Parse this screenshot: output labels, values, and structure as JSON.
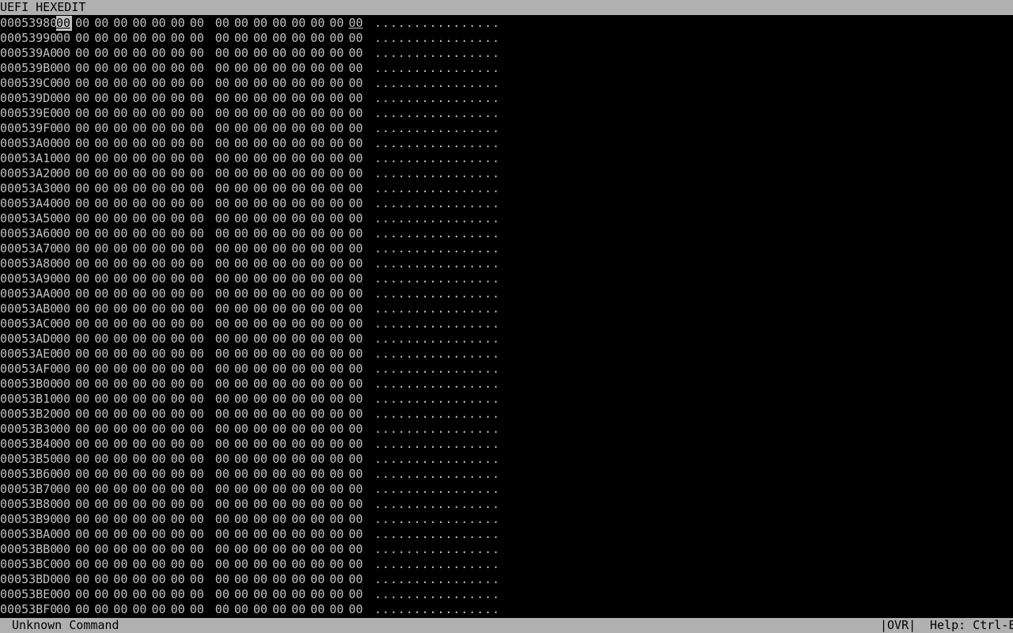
{
  "title": "UEFI HEXEDIT",
  "status": {
    "message": "Unknown Command",
    "mode": "|OVR|",
    "help": "Help: Ctrl-E"
  },
  "cursor": {
    "row": 0,
    "byte": 0
  },
  "rows": [
    {
      "address": "00053980",
      "bytes": [
        "00",
        "00",
        "00",
        "00",
        "00",
        "00",
        "00",
        "00",
        "00",
        "00",
        "00",
        "00",
        "00",
        "00",
        "00",
        "00"
      ],
      "ascii": "................"
    },
    {
      "address": "00053990",
      "bytes": [
        "00",
        "00",
        "00",
        "00",
        "00",
        "00",
        "00",
        "00",
        "00",
        "00",
        "00",
        "00",
        "00",
        "00",
        "00",
        "00"
      ],
      "ascii": "................"
    },
    {
      "address": "000539A0",
      "bytes": [
        "00",
        "00",
        "00",
        "00",
        "00",
        "00",
        "00",
        "00",
        "00",
        "00",
        "00",
        "00",
        "00",
        "00",
        "00",
        "00"
      ],
      "ascii": "................"
    },
    {
      "address": "000539B0",
      "bytes": [
        "00",
        "00",
        "00",
        "00",
        "00",
        "00",
        "00",
        "00",
        "00",
        "00",
        "00",
        "00",
        "00",
        "00",
        "00",
        "00"
      ],
      "ascii": "................"
    },
    {
      "address": "000539C0",
      "bytes": [
        "00",
        "00",
        "00",
        "00",
        "00",
        "00",
        "00",
        "00",
        "00",
        "00",
        "00",
        "00",
        "00",
        "00",
        "00",
        "00"
      ],
      "ascii": "................"
    },
    {
      "address": "000539D0",
      "bytes": [
        "00",
        "00",
        "00",
        "00",
        "00",
        "00",
        "00",
        "00",
        "00",
        "00",
        "00",
        "00",
        "00",
        "00",
        "00",
        "00"
      ],
      "ascii": "................"
    },
    {
      "address": "000539E0",
      "bytes": [
        "00",
        "00",
        "00",
        "00",
        "00",
        "00",
        "00",
        "00",
        "00",
        "00",
        "00",
        "00",
        "00",
        "00",
        "00",
        "00"
      ],
      "ascii": "................"
    },
    {
      "address": "000539F0",
      "bytes": [
        "00",
        "00",
        "00",
        "00",
        "00",
        "00",
        "00",
        "00",
        "00",
        "00",
        "00",
        "00",
        "00",
        "00",
        "00",
        "00"
      ],
      "ascii": "................"
    },
    {
      "address": "00053A00",
      "bytes": [
        "00",
        "00",
        "00",
        "00",
        "00",
        "00",
        "00",
        "00",
        "00",
        "00",
        "00",
        "00",
        "00",
        "00",
        "00",
        "00"
      ],
      "ascii": "................"
    },
    {
      "address": "00053A10",
      "bytes": [
        "00",
        "00",
        "00",
        "00",
        "00",
        "00",
        "00",
        "00",
        "00",
        "00",
        "00",
        "00",
        "00",
        "00",
        "00",
        "00"
      ],
      "ascii": "................"
    },
    {
      "address": "00053A20",
      "bytes": [
        "00",
        "00",
        "00",
        "00",
        "00",
        "00",
        "00",
        "00",
        "00",
        "00",
        "00",
        "00",
        "00",
        "00",
        "00",
        "00"
      ],
      "ascii": "................"
    },
    {
      "address": "00053A30",
      "bytes": [
        "00",
        "00",
        "00",
        "00",
        "00",
        "00",
        "00",
        "00",
        "00",
        "00",
        "00",
        "00",
        "00",
        "00",
        "00",
        "00"
      ],
      "ascii": "................"
    },
    {
      "address": "00053A40",
      "bytes": [
        "00",
        "00",
        "00",
        "00",
        "00",
        "00",
        "00",
        "00",
        "00",
        "00",
        "00",
        "00",
        "00",
        "00",
        "00",
        "00"
      ],
      "ascii": "................"
    },
    {
      "address": "00053A50",
      "bytes": [
        "00",
        "00",
        "00",
        "00",
        "00",
        "00",
        "00",
        "00",
        "00",
        "00",
        "00",
        "00",
        "00",
        "00",
        "00",
        "00"
      ],
      "ascii": "................"
    },
    {
      "address": "00053A60",
      "bytes": [
        "00",
        "00",
        "00",
        "00",
        "00",
        "00",
        "00",
        "00",
        "00",
        "00",
        "00",
        "00",
        "00",
        "00",
        "00",
        "00"
      ],
      "ascii": "................"
    },
    {
      "address": "00053A70",
      "bytes": [
        "00",
        "00",
        "00",
        "00",
        "00",
        "00",
        "00",
        "00",
        "00",
        "00",
        "00",
        "00",
        "00",
        "00",
        "00",
        "00"
      ],
      "ascii": "................"
    },
    {
      "address": "00053A80",
      "bytes": [
        "00",
        "00",
        "00",
        "00",
        "00",
        "00",
        "00",
        "00",
        "00",
        "00",
        "00",
        "00",
        "00",
        "00",
        "00",
        "00"
      ],
      "ascii": "................"
    },
    {
      "address": "00053A90",
      "bytes": [
        "00",
        "00",
        "00",
        "00",
        "00",
        "00",
        "00",
        "00",
        "00",
        "00",
        "00",
        "00",
        "00",
        "00",
        "00",
        "00"
      ],
      "ascii": "................"
    },
    {
      "address": "00053AA0",
      "bytes": [
        "00",
        "00",
        "00",
        "00",
        "00",
        "00",
        "00",
        "00",
        "00",
        "00",
        "00",
        "00",
        "00",
        "00",
        "00",
        "00"
      ],
      "ascii": "................"
    },
    {
      "address": "00053AB0",
      "bytes": [
        "00",
        "00",
        "00",
        "00",
        "00",
        "00",
        "00",
        "00",
        "00",
        "00",
        "00",
        "00",
        "00",
        "00",
        "00",
        "00"
      ],
      "ascii": "................"
    },
    {
      "address": "00053AC0",
      "bytes": [
        "00",
        "00",
        "00",
        "00",
        "00",
        "00",
        "00",
        "00",
        "00",
        "00",
        "00",
        "00",
        "00",
        "00",
        "00",
        "00"
      ],
      "ascii": "................"
    },
    {
      "address": "00053AD0",
      "bytes": [
        "00",
        "00",
        "00",
        "00",
        "00",
        "00",
        "00",
        "00",
        "00",
        "00",
        "00",
        "00",
        "00",
        "00",
        "00",
        "00"
      ],
      "ascii": "................"
    },
    {
      "address": "00053AE0",
      "bytes": [
        "00",
        "00",
        "00",
        "00",
        "00",
        "00",
        "00",
        "00",
        "00",
        "00",
        "00",
        "00",
        "00",
        "00",
        "00",
        "00"
      ],
      "ascii": "................"
    },
    {
      "address": "00053AF0",
      "bytes": [
        "00",
        "00",
        "00",
        "00",
        "00",
        "00",
        "00",
        "00",
        "00",
        "00",
        "00",
        "00",
        "00",
        "00",
        "00",
        "00"
      ],
      "ascii": "................"
    },
    {
      "address": "00053B00",
      "bytes": [
        "00",
        "00",
        "00",
        "00",
        "00",
        "00",
        "00",
        "00",
        "00",
        "00",
        "00",
        "00",
        "00",
        "00",
        "00",
        "00"
      ],
      "ascii": "................"
    },
    {
      "address": "00053B10",
      "bytes": [
        "00",
        "00",
        "00",
        "00",
        "00",
        "00",
        "00",
        "00",
        "00",
        "00",
        "00",
        "00",
        "00",
        "00",
        "00",
        "00"
      ],
      "ascii": "................"
    },
    {
      "address": "00053B20",
      "bytes": [
        "00",
        "00",
        "00",
        "00",
        "00",
        "00",
        "00",
        "00",
        "00",
        "00",
        "00",
        "00",
        "00",
        "00",
        "00",
        "00"
      ],
      "ascii": "................"
    },
    {
      "address": "00053B30",
      "bytes": [
        "00",
        "00",
        "00",
        "00",
        "00",
        "00",
        "00",
        "00",
        "00",
        "00",
        "00",
        "00",
        "00",
        "00",
        "00",
        "00"
      ],
      "ascii": "................"
    },
    {
      "address": "00053B40",
      "bytes": [
        "00",
        "00",
        "00",
        "00",
        "00",
        "00",
        "00",
        "00",
        "00",
        "00",
        "00",
        "00",
        "00",
        "00",
        "00",
        "00"
      ],
      "ascii": "................"
    },
    {
      "address": "00053B50",
      "bytes": [
        "00",
        "00",
        "00",
        "00",
        "00",
        "00",
        "00",
        "00",
        "00",
        "00",
        "00",
        "00",
        "00",
        "00",
        "00",
        "00"
      ],
      "ascii": "................"
    },
    {
      "address": "00053B60",
      "bytes": [
        "00",
        "00",
        "00",
        "00",
        "00",
        "00",
        "00",
        "00",
        "00",
        "00",
        "00",
        "00",
        "00",
        "00",
        "00",
        "00"
      ],
      "ascii": "................"
    },
    {
      "address": "00053B70",
      "bytes": [
        "00",
        "00",
        "00",
        "00",
        "00",
        "00",
        "00",
        "00",
        "00",
        "00",
        "00",
        "00",
        "00",
        "00",
        "00",
        "00"
      ],
      "ascii": "................"
    },
    {
      "address": "00053B80",
      "bytes": [
        "00",
        "00",
        "00",
        "00",
        "00",
        "00",
        "00",
        "00",
        "00",
        "00",
        "00",
        "00",
        "00",
        "00",
        "00",
        "00"
      ],
      "ascii": "................"
    },
    {
      "address": "00053B90",
      "bytes": [
        "00",
        "00",
        "00",
        "00",
        "00",
        "00",
        "00",
        "00",
        "00",
        "00",
        "00",
        "00",
        "00",
        "00",
        "00",
        "00"
      ],
      "ascii": "................"
    },
    {
      "address": "00053BA0",
      "bytes": [
        "00",
        "00",
        "00",
        "00",
        "00",
        "00",
        "00",
        "00",
        "00",
        "00",
        "00",
        "00",
        "00",
        "00",
        "00",
        "00"
      ],
      "ascii": "................"
    },
    {
      "address": "00053BB0",
      "bytes": [
        "00",
        "00",
        "00",
        "00",
        "00",
        "00",
        "00",
        "00",
        "00",
        "00",
        "00",
        "00",
        "00",
        "00",
        "00",
        "00"
      ],
      "ascii": "................"
    },
    {
      "address": "00053BC0",
      "bytes": [
        "00",
        "00",
        "00",
        "00",
        "00",
        "00",
        "00",
        "00",
        "00",
        "00",
        "00",
        "00",
        "00",
        "00",
        "00",
        "00"
      ],
      "ascii": "................"
    },
    {
      "address": "00053BD0",
      "bytes": [
        "00",
        "00",
        "00",
        "00",
        "00",
        "00",
        "00",
        "00",
        "00",
        "00",
        "00",
        "00",
        "00",
        "00",
        "00",
        "00"
      ],
      "ascii": "................"
    },
    {
      "address": "00053BE0",
      "bytes": [
        "00",
        "00",
        "00",
        "00",
        "00",
        "00",
        "00",
        "00",
        "00",
        "00",
        "00",
        "00",
        "00",
        "00",
        "00",
        "00"
      ],
      "ascii": "................"
    },
    {
      "address": "00053BF0",
      "bytes": [
        "00",
        "00",
        "00",
        "00",
        "00",
        "00",
        "00",
        "00",
        "00",
        "00",
        "00",
        "00",
        "00",
        "00",
        "00",
        "00"
      ],
      "ascii": "................"
    }
  ]
}
